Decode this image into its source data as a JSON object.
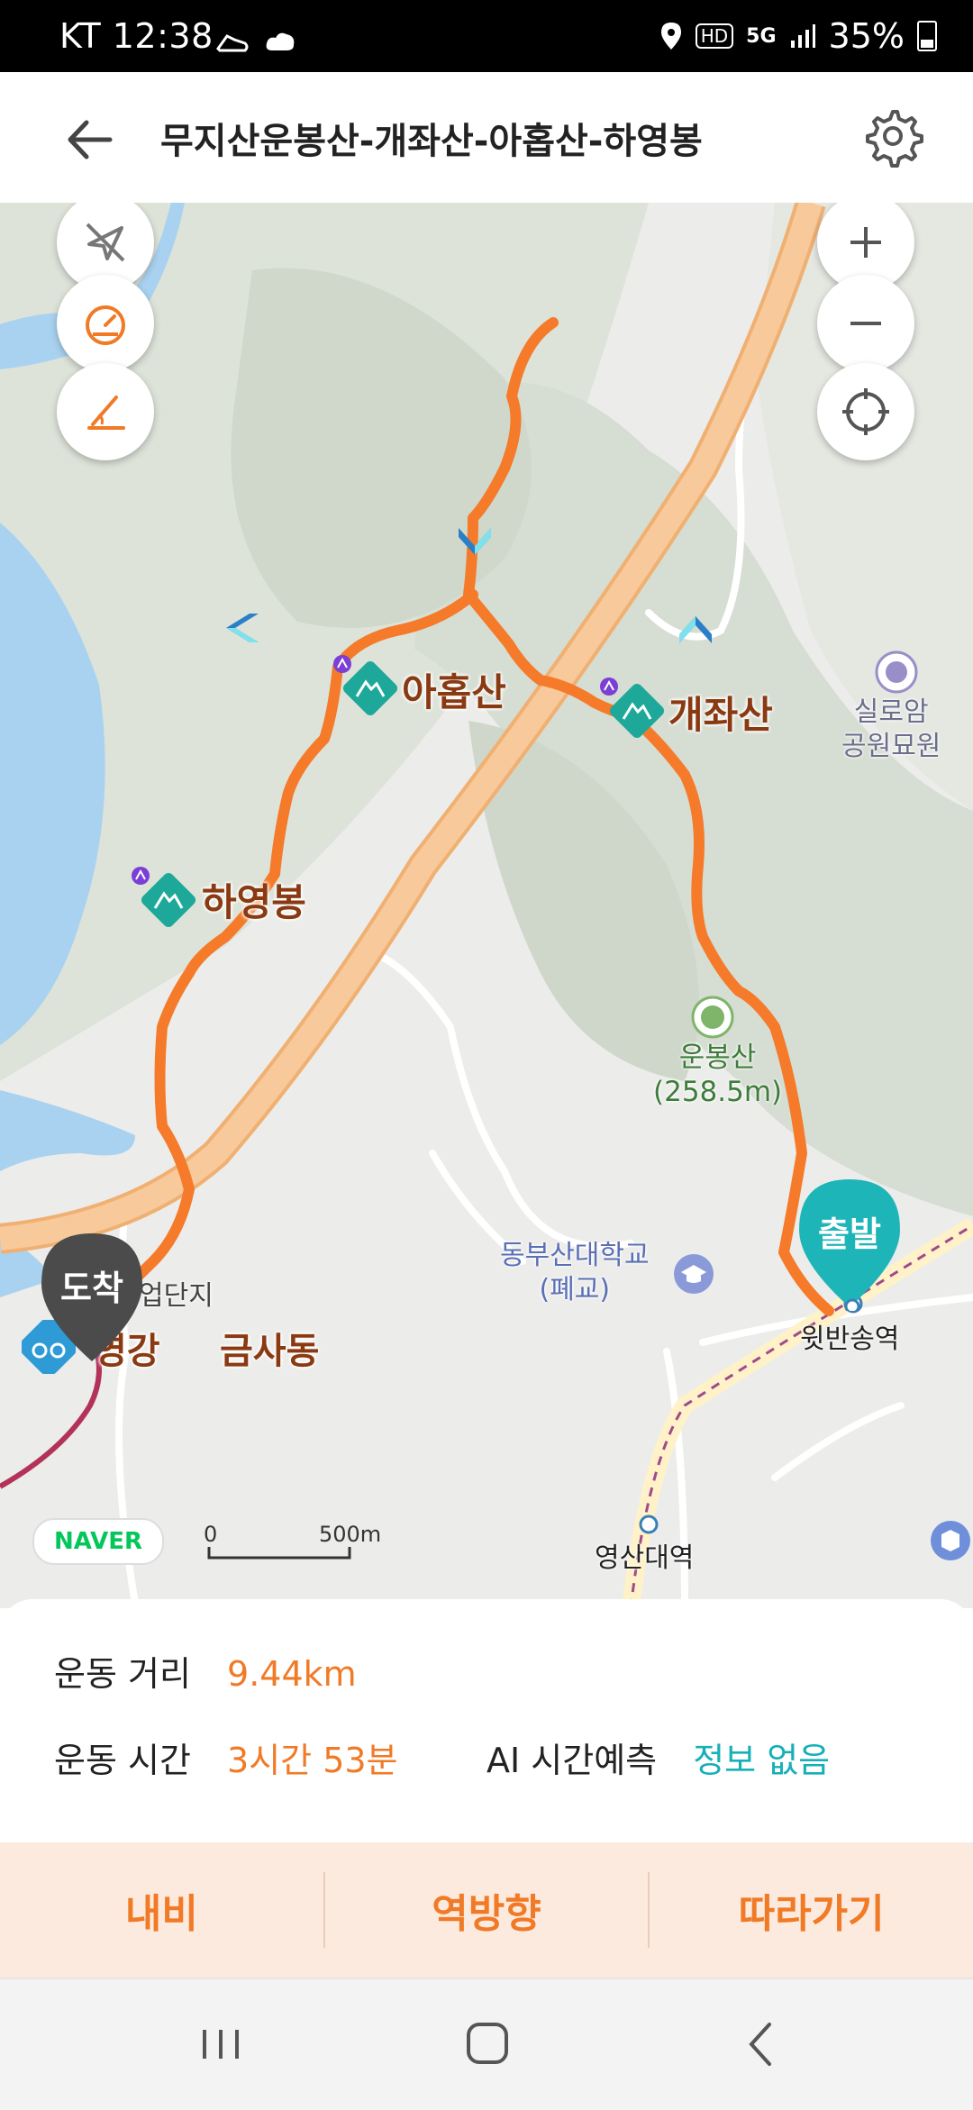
{
  "status_bar": {
    "carrier_time": "KT 12:38",
    "hd": "HD",
    "network": "5G",
    "battery": "35%"
  },
  "header": {
    "title": "무지산운봉산-개좌산-아홉산-하영봉"
  },
  "map": {
    "peaks": [
      "아홉산",
      "개좌산",
      "하영봉"
    ],
    "poi": {
      "silroam": "실로암\n공원묘원",
      "unbong": "운봉산\n(258.5m)",
      "college": "동부산대학교\n(폐교)",
      "station1": "윗반송역",
      "station2": "영산대역",
      "geumsa": "금사동",
      "yeonggang": "영강",
      "industrial": "업단지"
    },
    "start_label": "출발",
    "end_label": "도착",
    "naver": "NAVER",
    "scale": {
      "zero": "0",
      "dist": "500m"
    },
    "route_color": "#f57a2a"
  },
  "info": {
    "distance_label": "운동 거리",
    "distance_value": "9.44km",
    "time_label": "운동 시간",
    "time_value": "3시간 53분",
    "ai_label": "AI 시간예측",
    "ai_value": "정보 없음"
  },
  "actions": {
    "navi": "내비",
    "reverse": "역방향",
    "follow": "따라가기"
  },
  "colors": {
    "accent": "#f07a26",
    "teal": "#17b0b6",
    "peak_marker": "#1ea89a"
  }
}
